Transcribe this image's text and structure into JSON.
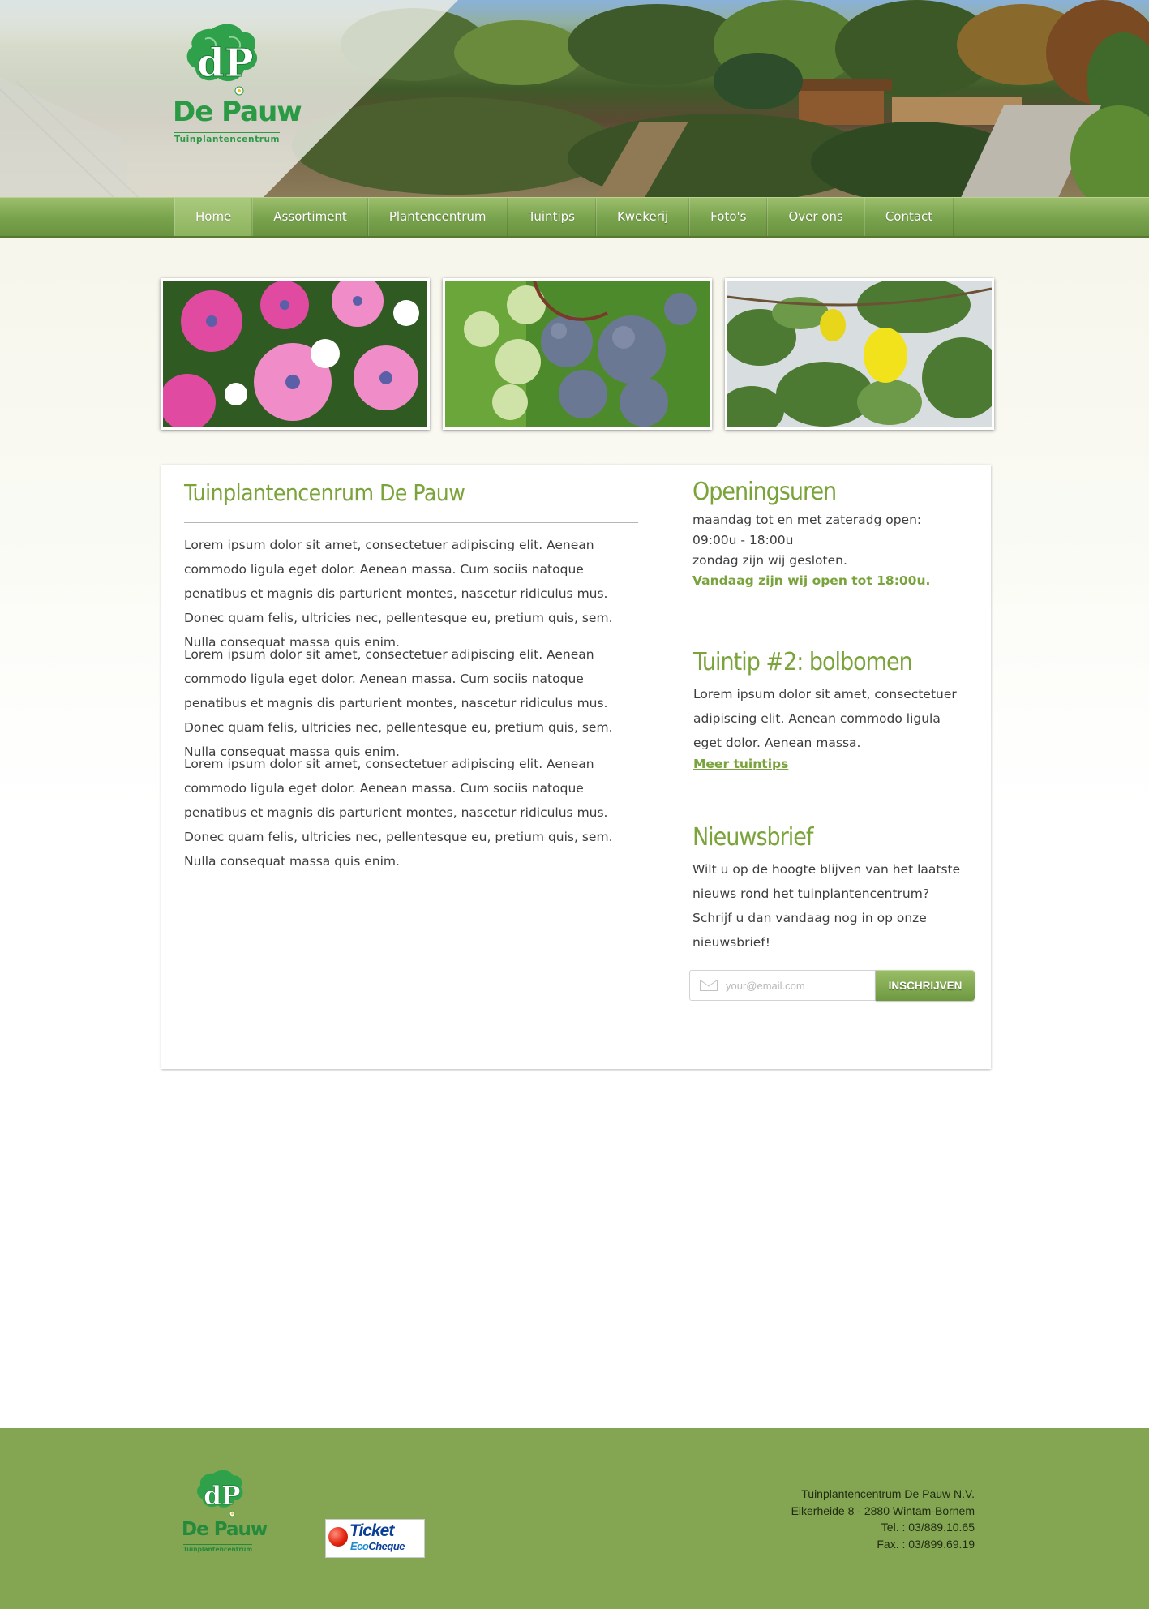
{
  "logo": {
    "monogram": "dP",
    "name": "De Pauw",
    "tagline": "Tuinplantencentrum"
  },
  "nav": {
    "items": [
      "Home",
      "Assortiment",
      "Plantencentrum",
      "Tuintips",
      "Kwekerij",
      "Foto's",
      "Over ons",
      "Contact"
    ],
    "active": "Home"
  },
  "gallery": [
    "flowers-photo",
    "blueberries-photo",
    "quince-photo"
  ],
  "main": {
    "title": "Tuinplantencenrum De Pauw",
    "paragraphs": [
      "Lorem ipsum dolor sit amet, consectetuer adipiscing elit. Aenean commodo ligula eget dolor. Aenean massa. Cum sociis natoque penatibus et magnis dis parturient montes, nascetur ridiculus mus. Donec quam felis, ultricies nec, pellentesque eu, pretium quis, sem. Nulla consequat massa quis enim.",
      "Lorem ipsum dolor sit amet, consectetuer adipiscing elit. Aenean commodo ligula eget dolor. Aenean massa. Cum sociis natoque penatibus et magnis dis parturient montes, nascetur ridiculus mus. Donec quam felis, ultricies nec, pellentesque eu, pretium quis, sem. Nulla consequat massa quis enim.",
      "Lorem ipsum dolor sit amet, consectetuer adipiscing elit. Aenean commodo ligula eget dolor. Aenean massa. Cum sociis natoque penatibus et magnis dis parturient montes, nascetur ridiculus mus. Donec quam felis, ultricies nec, pellentesque eu, pretium quis, sem. Nulla consequat massa quis enim."
    ]
  },
  "hours": {
    "title": "Openingsuren",
    "line1": "maandag tot en met zateradg open:",
    "line2": "09:00u - 18:00u",
    "line3": "zondag zijn wij gesloten.",
    "today": "Vandaag zijn wij open tot 18:00u."
  },
  "tip": {
    "title": "Tuintip #2: bolbomen",
    "text": "Lorem ipsum dolor sit amet, consectetuer adipiscing elit. Aenean commodo ligula eget dolor. Aenean massa.",
    "link": "Meer tuintips"
  },
  "newsletter": {
    "title": "Nieuwsbrief",
    "text": "Wilt u op de hoogte blijven van het laatste nieuws rond het tuinplantencentrum? Schrijf u dan vandaag nog in op onze nieuwsbrief!",
    "placeholder": "your@email.com",
    "button": "INSCHRIJVEN"
  },
  "footer": {
    "ticket_main": "Ticket",
    "ticket_sub_a": "Eco",
    "ticket_sub_b": "Cheque",
    "company": "Tuinplantencentrum De Pauw N.V.",
    "street": "Eikerheide 8 - 2880 Wintam-Bornem",
    "tel": "Tel. : 03/889.10.65",
    "fax": "Fax. : 03/899.69.19"
  },
  "colors": {
    "brand_green": "#7aa33a",
    "logo_green": "#2a9a45",
    "footer_bg": "#84a653",
    "ticket_blue": "#0b3f95"
  }
}
